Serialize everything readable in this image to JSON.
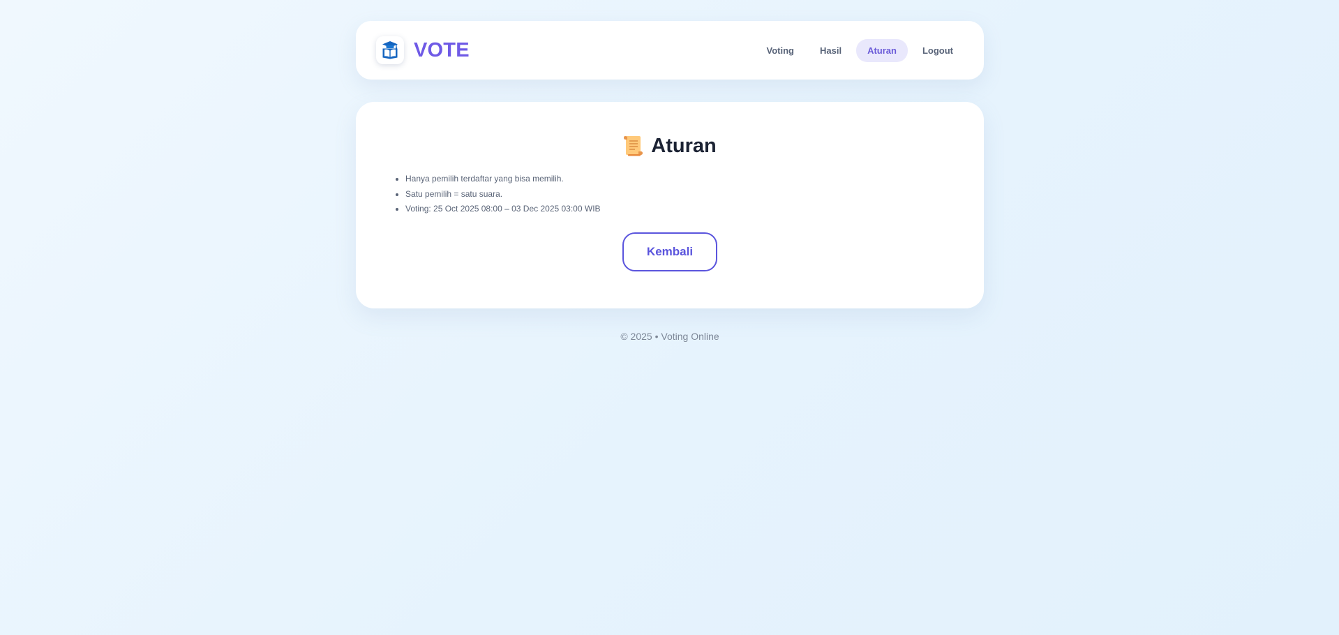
{
  "header": {
    "brand_title": "VOTE",
    "logo_icon": "graduation-book-icon",
    "nav": [
      {
        "label": "Voting",
        "active": false
      },
      {
        "label": "Hasil",
        "active": false
      },
      {
        "label": "Aturan",
        "active": true
      },
      {
        "label": "Logout",
        "active": false
      }
    ]
  },
  "main": {
    "title_icon": "scroll-icon",
    "title": "Aturan",
    "rules": [
      "Hanya pemilih terdaftar yang bisa memilih.",
      "Satu pemilih = satu suara.",
      "Voting: 25 Oct 2025 08:00 – 03 Dec 2025 03:00 WIB"
    ],
    "back_button": "Kembali"
  },
  "footer": {
    "text": "© 2025 • Voting Online"
  },
  "colors": {
    "accent": "#6f5ae6",
    "button_accent": "#5b55dd",
    "active_nav_bg": "#e9e8fc",
    "background": "#eaf5fd"
  }
}
